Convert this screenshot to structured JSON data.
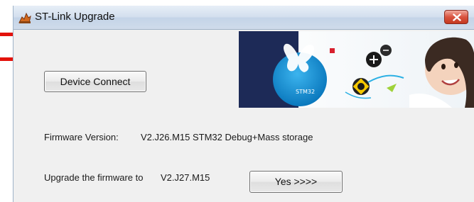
{
  "window": {
    "title": "ST-Link Upgrade"
  },
  "banner": {
    "chip_text": "STM32"
  },
  "buttons": {
    "device_connect": "Device Connect",
    "yes": "Yes >>>>"
  },
  "firmware": {
    "label": "Firmware Version:",
    "value": "V2.J26.M15 STM32 Debug+Mass storage"
  },
  "upgrade": {
    "label": "Upgrade the firmware to",
    "target": "V2.J27.M15"
  },
  "colors": {
    "callout_red": "#e3120b",
    "close_button_red": "#c4391f",
    "banner_navy": "#1d2a57",
    "stm32_blue": "#0f8fd1"
  },
  "icons": {
    "app": "st-link-app-icon",
    "close": "close-icon"
  }
}
